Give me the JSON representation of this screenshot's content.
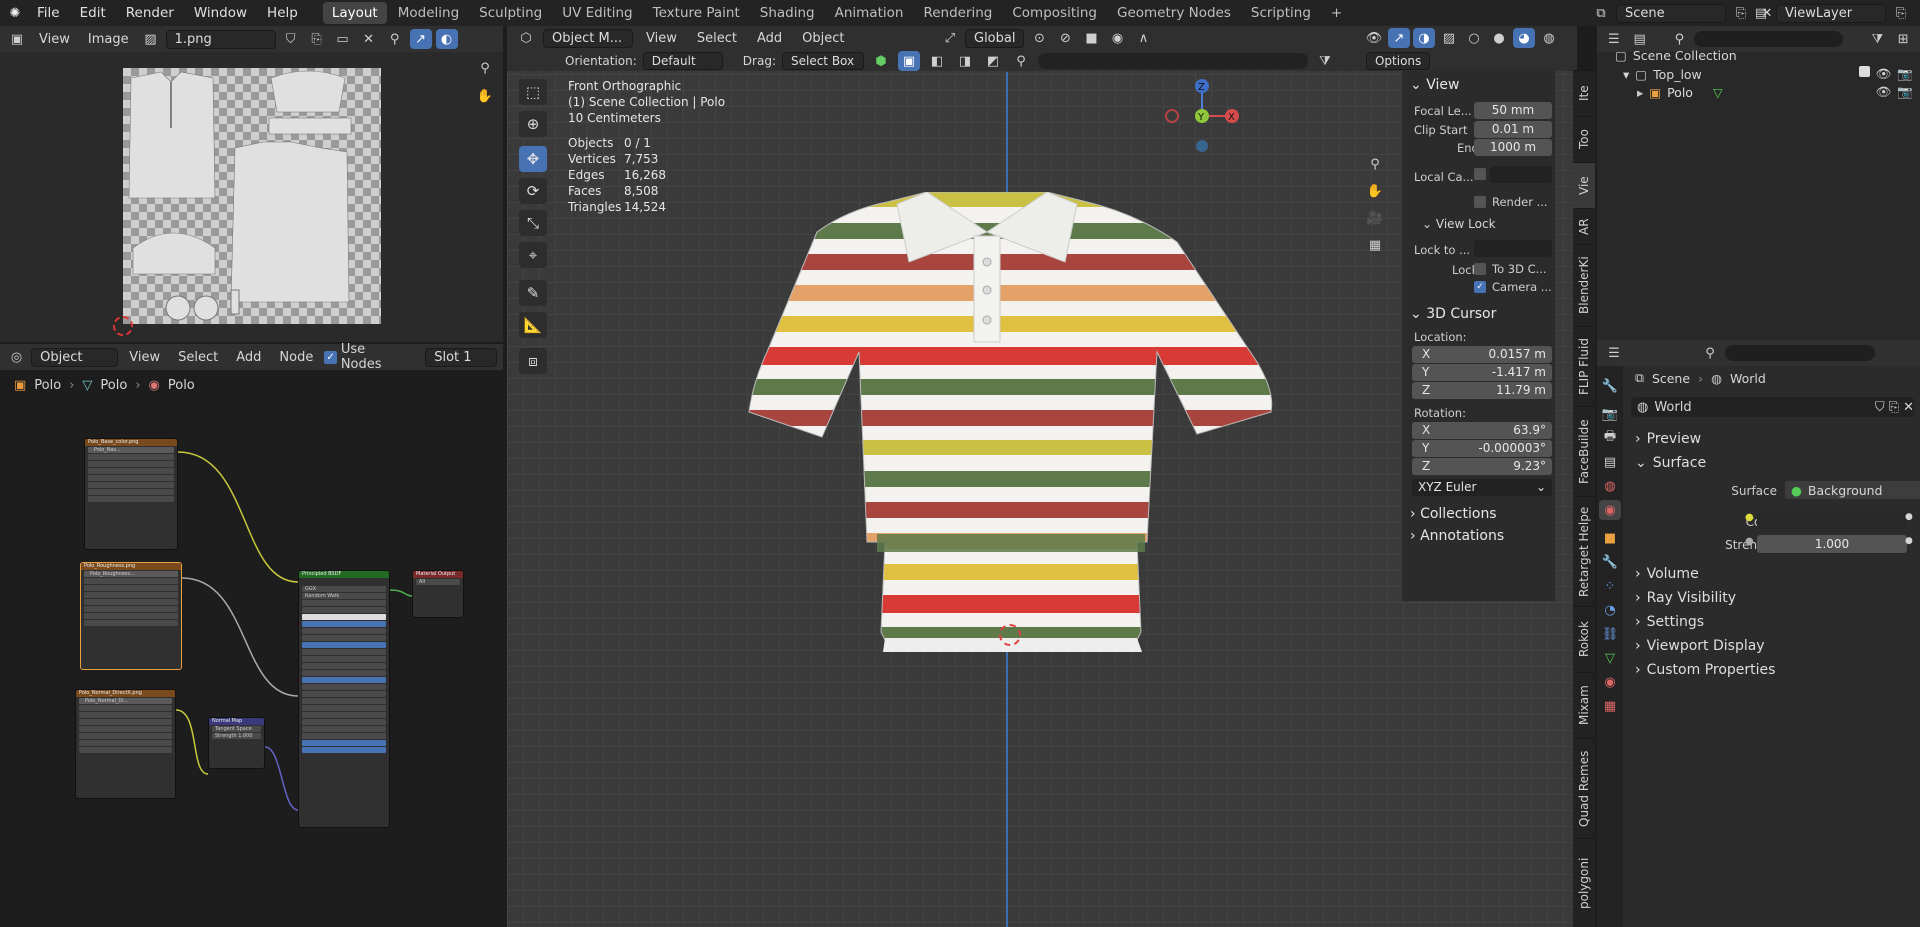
{
  "menubar": {
    "items": [
      "File",
      "Edit",
      "Render",
      "Window",
      "Help"
    ],
    "workspaces": [
      "Layout",
      "Modeling",
      "Sculpting",
      "UV Editing",
      "Texture Paint",
      "Shading",
      "Animation",
      "Rendering",
      "Compositing",
      "Geometry Nodes",
      "Scripting"
    ],
    "active_workspace": "Layout",
    "add_tab": "+",
    "scene": "Scene",
    "view_layer": "ViewLayer"
  },
  "image_editor": {
    "menus": [
      "View",
      "Image"
    ],
    "image_name": "1.png"
  },
  "node_editor": {
    "mode": "Object",
    "menus": [
      "View",
      "Select",
      "Add",
      "Node"
    ],
    "use_nodes_label": "Use Nodes",
    "slot": "Slot 1",
    "breadcrumb": [
      "Polo",
      "Polo",
      "Polo"
    ],
    "nodes": {
      "base_color": {
        "title": "Polo_Base_color.png",
        "image": "Polo_Bas..."
      },
      "roughness": {
        "title": "Polo_Roughness.png",
        "image": "Polo_Roughness..."
      },
      "normal_tex": {
        "title": "Polo_Normal_DirectX.png",
        "image": "Polo_Normal_Di..."
      },
      "normal_map": {
        "title": "Normal Map",
        "space": "Tangent Space",
        "strength": "Strength 1.000"
      },
      "bsdf": {
        "title": "Principled BSDF",
        "dist": "GGX",
        "sss": "Random Walk"
      },
      "output": {
        "title": "Material Output",
        "target": "All"
      }
    }
  },
  "viewport": {
    "mode": "Object M...",
    "menus": [
      "View",
      "Select",
      "Add",
      "Object"
    ],
    "orientation_label": "Orientation:",
    "orientation": "Default",
    "drag_label": "Drag:",
    "drag": "Select Box",
    "transform": "Global",
    "options": "Options",
    "overlay_title": "Front Orthographic",
    "overlay_collection": "(1) Scene Collection | Polo",
    "overlay_scale": "10 Centimeters",
    "stats": [
      {
        "k": "Objects",
        "v": "0 / 1"
      },
      {
        "k": "Vertices",
        "v": "7,753"
      },
      {
        "k": "Edges",
        "v": "16,268"
      },
      {
        "k": "Faces",
        "v": "8,508"
      },
      {
        "k": "Triangles",
        "v": "14,524"
      }
    ],
    "gizmo": {
      "x": "X",
      "y": "Y",
      "z": "Z"
    }
  },
  "npanel": {
    "view_header": "View",
    "focal_label": "Focal Le...",
    "focal": "50 mm",
    "clip_start_label": "Clip Start",
    "clip_start": "0.01 m",
    "end_label": "End",
    "end": "1000 m",
    "local_cam_label": "Local Ca...",
    "render_label": "Render ...",
    "view_lock_header": "View Lock",
    "lock_to_label": "Lock to ...",
    "lock_label": "Lock",
    "to3d_label": "To 3D C...",
    "camera_label": "Camera ...",
    "cursor_header": "3D Cursor",
    "location_label": "Location:",
    "loc_x": "0.0157 m",
    "loc_y": "-1.417 m",
    "loc_z": "11.79 m",
    "rotation_label": "Rotation:",
    "rot_x": "63.9°",
    "rot_y": "-0.000003°",
    "rot_z": "9.23°",
    "rot_mode": "XYZ Euler",
    "collections": "Collections",
    "annotations": "Annotations",
    "tabs": [
      "Ite",
      "Too",
      "Vie",
      "AR",
      "BlenderKi",
      "FLIP Fluid",
      "FaceBuilde",
      "Retarget Helpe",
      "Rokok",
      "Mixam",
      "Quad Remes",
      "polygoni"
    ]
  },
  "outliner": {
    "root": "Scene Collection",
    "collection": "Top_low",
    "object": "Polo"
  },
  "properties": {
    "breadcrumb": [
      "Scene",
      "World"
    ],
    "world_name": "World",
    "sections": [
      "Preview",
      "Surface"
    ],
    "surface_label": "Surface",
    "surface_value": "Background",
    "color_label": "Color",
    "strength_label": "Strength",
    "strength_value": "1.000",
    "more_sections": [
      "Volume",
      "Ray Visibility",
      "Settings",
      "Viewport Display",
      "Custom Properties"
    ]
  },
  "colors": {
    "accent": "#4772b3",
    "stripe_red": "#d83a35",
    "stripe_green": "#5e7a4a",
    "stripe_yellow": "#e0c040",
    "stripe_orange": "#e3a268",
    "stripe_maroon": "#a8453f"
  }
}
